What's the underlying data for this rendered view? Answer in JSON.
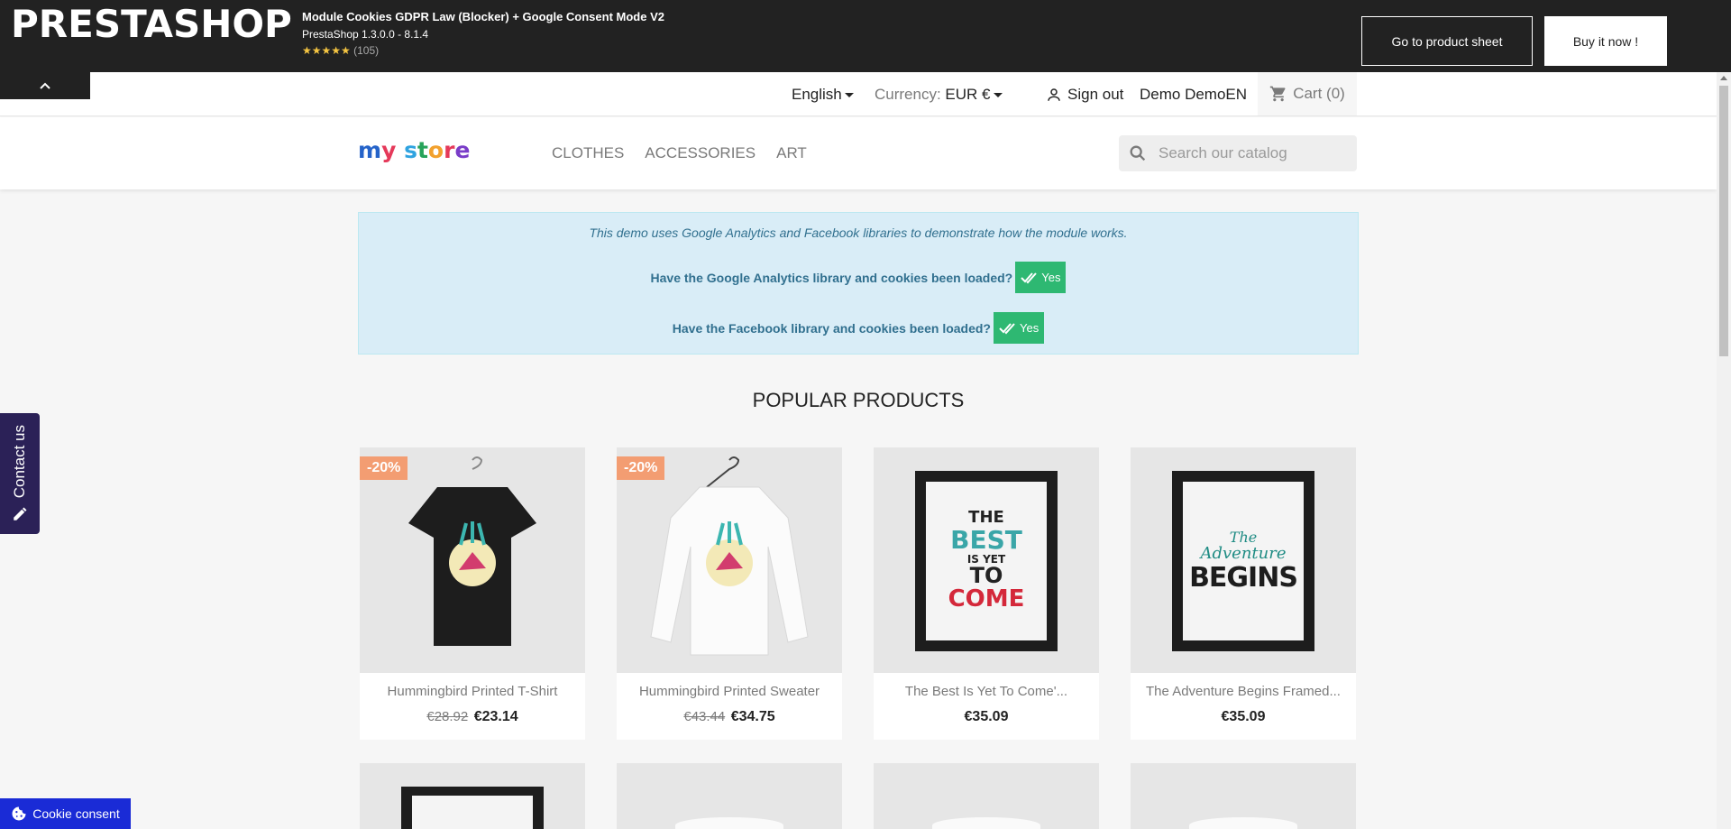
{
  "promo": {
    "logo": "PRESTASHOP",
    "module_title": "Module Cookies GDPR Law (Blocker) + Google Consent Mode V2",
    "versions": "PrestaShop 1.3.0.0 - 8.1.4",
    "stars": "★★★★★",
    "review_count": "(105)",
    "btn_sheet": "Go to product sheet",
    "btn_buy": "Buy it now !"
  },
  "nav": {
    "language": "English",
    "currency_label": "Currency:",
    "currency_value": "EUR €",
    "signout": "Sign out",
    "user": "Demo DemoEN",
    "cart": "Cart (0)"
  },
  "header": {
    "logo_text": "my store",
    "menu": [
      "CLOTHES",
      "ACCESSORIES",
      "ART"
    ],
    "search_placeholder": "Search our catalog"
  },
  "notice": {
    "intro": "This demo uses Google Analytics and Facebook libraries to demonstrate how the module works.",
    "q1": "Have the Google Analytics library and cookies been loaded?",
    "q2": "Have the Facebook library and cookies been loaded?",
    "yes": "Yes"
  },
  "section_title": "POPULAR PRODUCTS",
  "products": [
    {
      "name": "Hummingbird Printed T-Shirt",
      "discount": "-20%",
      "old_price": "€28.92",
      "price": "€23.14"
    },
    {
      "name": "Hummingbird Printed Sweater",
      "discount": "-20%",
      "old_price": "€43.44",
      "price": "€34.75"
    },
    {
      "name": "The Best Is Yet To Come'...",
      "price": "€35.09"
    },
    {
      "name": "The Adventure Begins Framed...",
      "price": "€35.09"
    }
  ],
  "poster1_text": [
    "THE",
    "BEST",
    "IS YET",
    "TO",
    "COME"
  ],
  "poster2_text": [
    "The",
    "Adventure",
    "BEGINS"
  ],
  "widgets": {
    "contact": "Contact us",
    "cookie": "Cookie consent"
  },
  "colors": {
    "banner": "#222222",
    "notice_bg": "#d9edf7",
    "notice_text": "#31708f",
    "yes_badge": "#2eb872",
    "discount": "#f39d72",
    "contact_tab": "#2b2157",
    "cookie_btn": "#1a2bd6"
  }
}
